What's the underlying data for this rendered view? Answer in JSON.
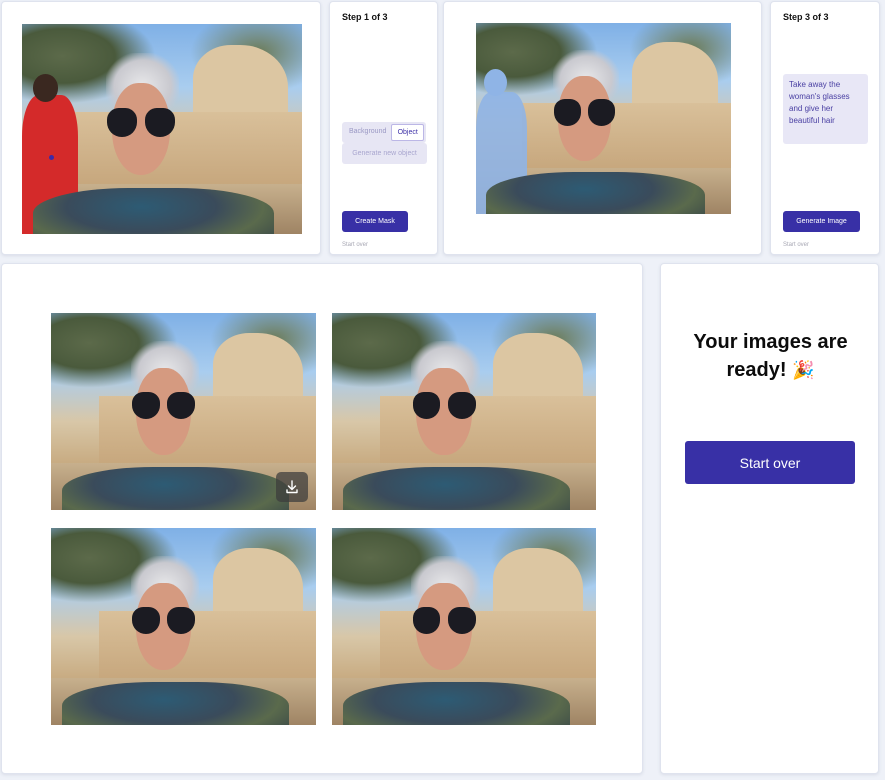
{
  "step1": {
    "title": "Step 1 of 3",
    "toggle": {
      "options": [
        "Background",
        "Object"
      ],
      "selected": "Object"
    },
    "generate_new_object_label": "Generate new object",
    "create_mask_label": "Create Mask",
    "start_over_label": "Start over"
  },
  "step3": {
    "title": "Step 3 of 3",
    "prompt_value": "Take away the woman's glasses and give her beautiful hair",
    "generate_image_label": "Generate Image",
    "start_over_label": "Start over"
  },
  "results": {
    "download_icon": "download-icon"
  },
  "ready_panel": {
    "title_line1": "Your images are",
    "title_line2": "ready!",
    "emoji": "🎉",
    "start_over_label": "Start over"
  },
  "colors": {
    "accent": "#3830a6",
    "accent_light": "#e7e6f4",
    "background": "#eef1f8",
    "mask": "#8fb4e6"
  }
}
